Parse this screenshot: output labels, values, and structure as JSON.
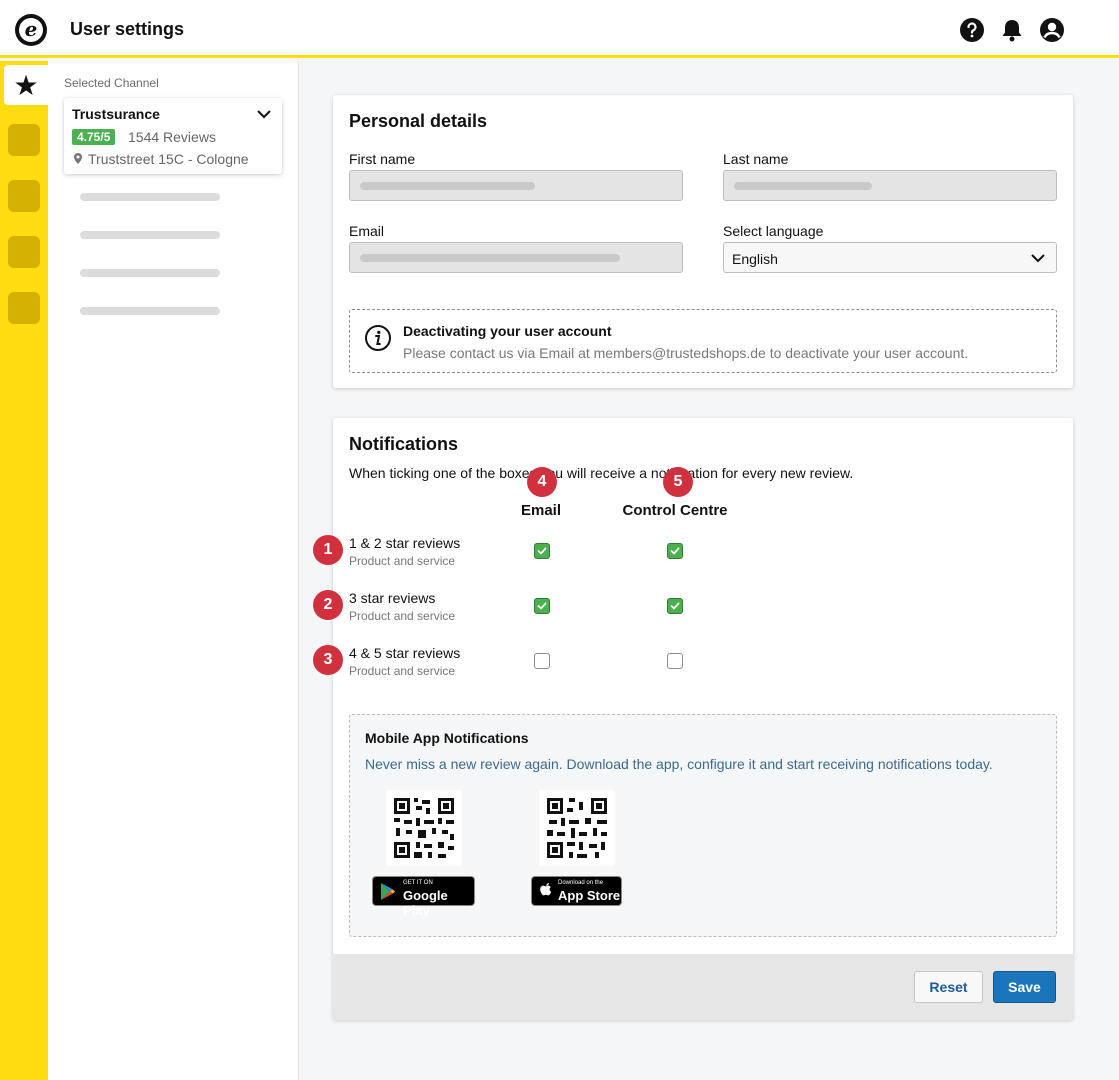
{
  "header": {
    "title": "User settings",
    "logo_letter": "e"
  },
  "channel": {
    "label": "Selected Channel",
    "name": "Trustsurance",
    "rating": "4.75/5",
    "reviews": "1544 Reviews",
    "address": "Truststreet 15C - Cologne"
  },
  "personal": {
    "title": "Personal details",
    "first_name_label": "First name",
    "last_name_label": "Last name",
    "email_label": "Email",
    "language_label": "Select language",
    "language_value": "English",
    "deactivate_title": "Deactivating your user account",
    "deactivate_text": "Please contact us via Email at members@trustedshops.de to deactivate your user account."
  },
  "notifications": {
    "title": "Notifications",
    "description": "When ticking one of the boxes you will receive a notification for every new review.",
    "columns": [
      "Email",
      "Control Centre"
    ],
    "rows": [
      {
        "title": "1 & 2 star reviews",
        "subtitle": "Product and service",
        "email": true,
        "control_centre": true
      },
      {
        "title": "3 star reviews",
        "subtitle": "Product and service",
        "email": true,
        "control_centre": true
      },
      {
        "title": "4 & 5 star reviews",
        "subtitle": "Product and service",
        "email": false,
        "control_centre": false
      }
    ],
    "mobile": {
      "title": "Mobile App Notifications",
      "text": "Never miss a new review again. Download the app, configure it and start receiving notifications today.",
      "google_small": "GET IT ON",
      "google_big": "Google Play",
      "apple_small": "Download on the",
      "apple_big": "App Store"
    },
    "reset_label": "Reset",
    "save_label": "Save"
  },
  "markers": [
    "1",
    "2",
    "3",
    "4",
    "5"
  ],
  "colors": {
    "brand_yellow": "#FFDC0F",
    "accent_blue": "#1b75bb",
    "check_green": "#4caf50",
    "marker_red": "#d1313e"
  },
  "icons": [
    "help-icon",
    "bell-icon",
    "account-icon",
    "star-icon",
    "chevron-down-icon",
    "location-pin-icon",
    "info-icon",
    "check-icon",
    "qr-code",
    "google-play-icon",
    "apple-icon"
  ]
}
